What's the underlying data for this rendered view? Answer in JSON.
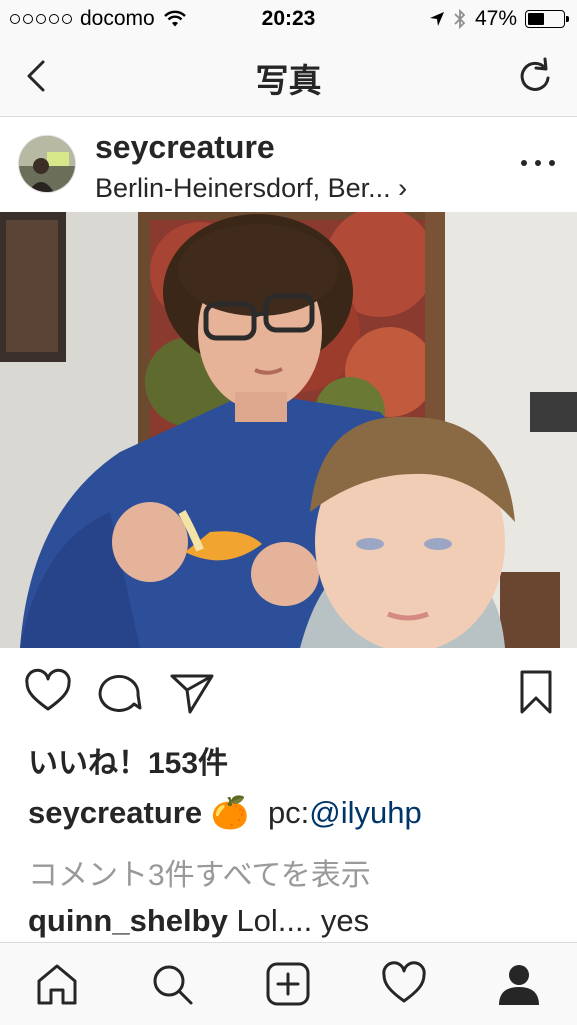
{
  "status_bar": {
    "carrier": "docomo",
    "time": "20:23",
    "battery_percent": "47%",
    "battery_level": 0.47
  },
  "nav": {
    "title": "写真"
  },
  "post": {
    "username": "seycreature",
    "location": "Berlin-Heinersdorf, Ber... ›",
    "likes": "いいね！153件",
    "caption_user": "seycreature",
    "caption_emoji": "🍊",
    "caption_prefix": "pc:",
    "caption_mention": "@ilyuhp",
    "view_comments": "コメント3件すべてを表示",
    "comment_user": "quinn_shelby",
    "comment_text": "Lol.... yes"
  },
  "icons": {
    "back": "chevron-left-icon",
    "refresh": "refresh-icon",
    "more": "more-horizontal-icon",
    "like": "heart-icon",
    "comment": "comment-icon",
    "share": "paper-plane-icon",
    "save": "bookmark-icon",
    "home": "home-icon",
    "search": "search-icon",
    "add": "plus-square-icon",
    "activity": "heart-icon",
    "profile": "profile-icon"
  },
  "colors": {
    "mention": "#003569",
    "muted_text": "#999999",
    "bar_background": "#f9f9f9"
  }
}
